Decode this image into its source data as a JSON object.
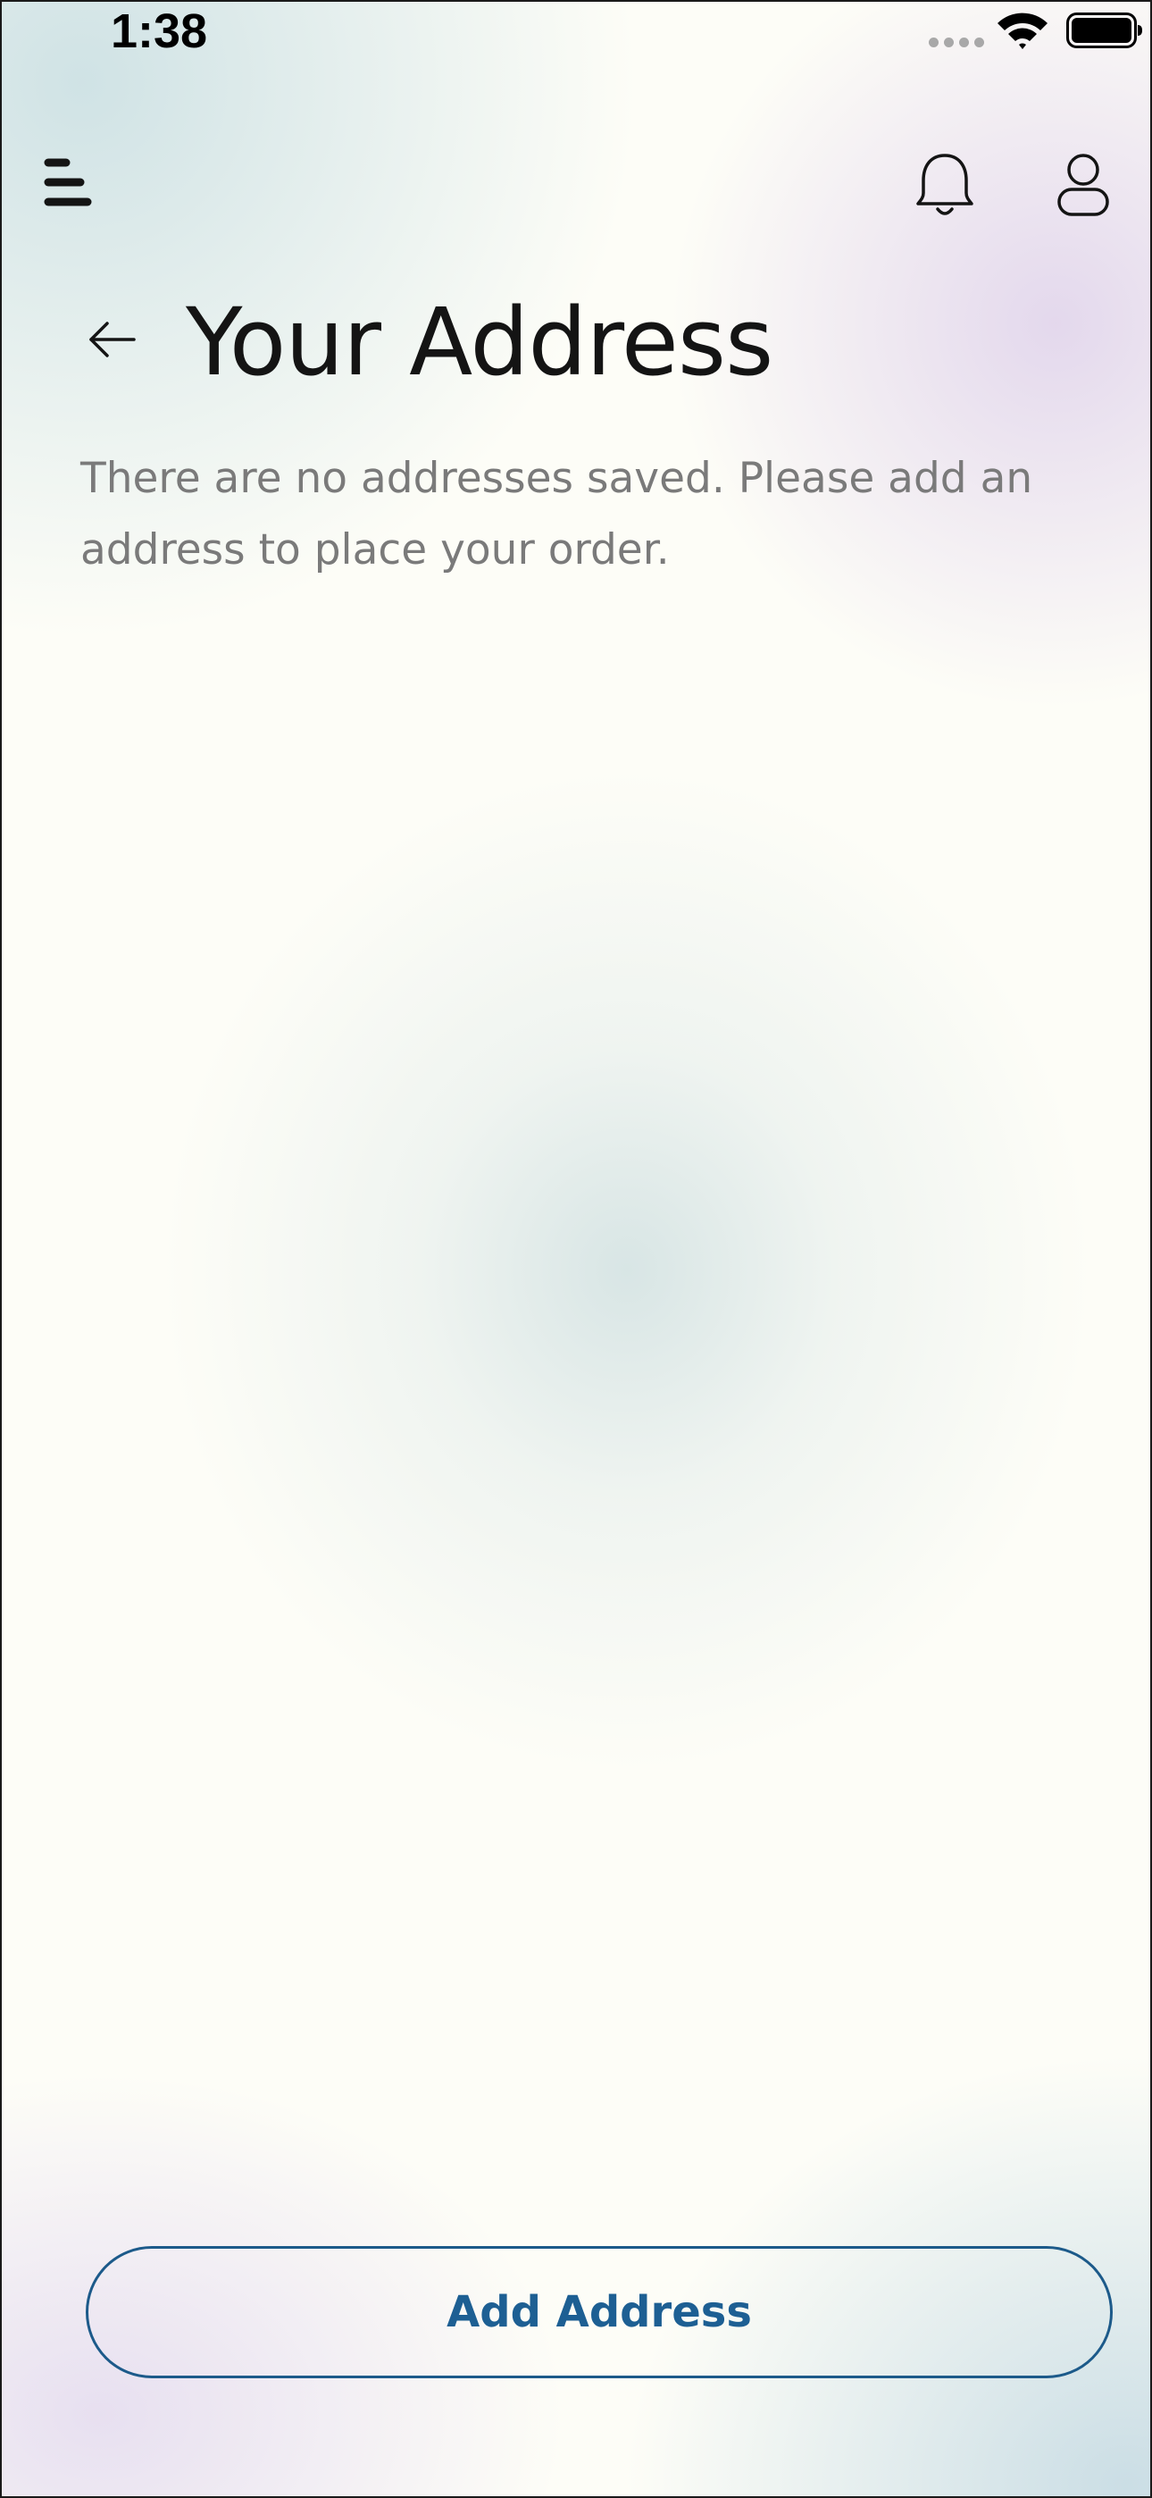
{
  "status_bar": {
    "time": "1:38"
  },
  "header": {
    "menu_icon": "menu-icon",
    "notifications_icon": "bell-icon",
    "profile_icon": "user-icon"
  },
  "page": {
    "back_icon": "arrow-left-icon",
    "title": "Your Address",
    "empty_message": "There are no addresses saved. Please add an address to place your order."
  },
  "actions": {
    "add_address_label": "Add Address"
  },
  "colors": {
    "accent": "#1d5f93",
    "title_text": "#141414",
    "body_text": "#7a7a7a"
  }
}
